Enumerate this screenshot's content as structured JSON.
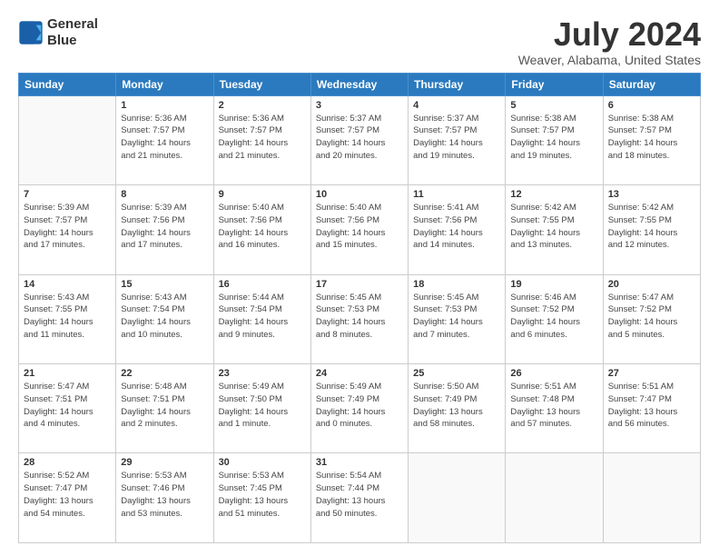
{
  "logo": {
    "line1": "General",
    "line2": "Blue"
  },
  "title": "July 2024",
  "subtitle": "Weaver, Alabama, United States",
  "headers": [
    "Sunday",
    "Monday",
    "Tuesday",
    "Wednesday",
    "Thursday",
    "Friday",
    "Saturday"
  ],
  "weeks": [
    [
      {
        "day": "",
        "info": ""
      },
      {
        "day": "1",
        "info": "Sunrise: 5:36 AM\nSunset: 7:57 PM\nDaylight: 14 hours\nand 21 minutes."
      },
      {
        "day": "2",
        "info": "Sunrise: 5:36 AM\nSunset: 7:57 PM\nDaylight: 14 hours\nand 21 minutes."
      },
      {
        "day": "3",
        "info": "Sunrise: 5:37 AM\nSunset: 7:57 PM\nDaylight: 14 hours\nand 20 minutes."
      },
      {
        "day": "4",
        "info": "Sunrise: 5:37 AM\nSunset: 7:57 PM\nDaylight: 14 hours\nand 19 minutes."
      },
      {
        "day": "5",
        "info": "Sunrise: 5:38 AM\nSunset: 7:57 PM\nDaylight: 14 hours\nand 19 minutes."
      },
      {
        "day": "6",
        "info": "Sunrise: 5:38 AM\nSunset: 7:57 PM\nDaylight: 14 hours\nand 18 minutes."
      }
    ],
    [
      {
        "day": "7",
        "info": "Sunrise: 5:39 AM\nSunset: 7:57 PM\nDaylight: 14 hours\nand 17 minutes."
      },
      {
        "day": "8",
        "info": "Sunrise: 5:39 AM\nSunset: 7:56 PM\nDaylight: 14 hours\nand 17 minutes."
      },
      {
        "day": "9",
        "info": "Sunrise: 5:40 AM\nSunset: 7:56 PM\nDaylight: 14 hours\nand 16 minutes."
      },
      {
        "day": "10",
        "info": "Sunrise: 5:40 AM\nSunset: 7:56 PM\nDaylight: 14 hours\nand 15 minutes."
      },
      {
        "day": "11",
        "info": "Sunrise: 5:41 AM\nSunset: 7:56 PM\nDaylight: 14 hours\nand 14 minutes."
      },
      {
        "day": "12",
        "info": "Sunrise: 5:42 AM\nSunset: 7:55 PM\nDaylight: 14 hours\nand 13 minutes."
      },
      {
        "day": "13",
        "info": "Sunrise: 5:42 AM\nSunset: 7:55 PM\nDaylight: 14 hours\nand 12 minutes."
      }
    ],
    [
      {
        "day": "14",
        "info": "Sunrise: 5:43 AM\nSunset: 7:55 PM\nDaylight: 14 hours\nand 11 minutes."
      },
      {
        "day": "15",
        "info": "Sunrise: 5:43 AM\nSunset: 7:54 PM\nDaylight: 14 hours\nand 10 minutes."
      },
      {
        "day": "16",
        "info": "Sunrise: 5:44 AM\nSunset: 7:54 PM\nDaylight: 14 hours\nand 9 minutes."
      },
      {
        "day": "17",
        "info": "Sunrise: 5:45 AM\nSunset: 7:53 PM\nDaylight: 14 hours\nand 8 minutes."
      },
      {
        "day": "18",
        "info": "Sunrise: 5:45 AM\nSunset: 7:53 PM\nDaylight: 14 hours\nand 7 minutes."
      },
      {
        "day": "19",
        "info": "Sunrise: 5:46 AM\nSunset: 7:52 PM\nDaylight: 14 hours\nand 6 minutes."
      },
      {
        "day": "20",
        "info": "Sunrise: 5:47 AM\nSunset: 7:52 PM\nDaylight: 14 hours\nand 5 minutes."
      }
    ],
    [
      {
        "day": "21",
        "info": "Sunrise: 5:47 AM\nSunset: 7:51 PM\nDaylight: 14 hours\nand 4 minutes."
      },
      {
        "day": "22",
        "info": "Sunrise: 5:48 AM\nSunset: 7:51 PM\nDaylight: 14 hours\nand 2 minutes."
      },
      {
        "day": "23",
        "info": "Sunrise: 5:49 AM\nSunset: 7:50 PM\nDaylight: 14 hours\nand 1 minute."
      },
      {
        "day": "24",
        "info": "Sunrise: 5:49 AM\nSunset: 7:49 PM\nDaylight: 14 hours\nand 0 minutes."
      },
      {
        "day": "25",
        "info": "Sunrise: 5:50 AM\nSunset: 7:49 PM\nDaylight: 13 hours\nand 58 minutes."
      },
      {
        "day": "26",
        "info": "Sunrise: 5:51 AM\nSunset: 7:48 PM\nDaylight: 13 hours\nand 57 minutes."
      },
      {
        "day": "27",
        "info": "Sunrise: 5:51 AM\nSunset: 7:47 PM\nDaylight: 13 hours\nand 56 minutes."
      }
    ],
    [
      {
        "day": "28",
        "info": "Sunrise: 5:52 AM\nSunset: 7:47 PM\nDaylight: 13 hours\nand 54 minutes."
      },
      {
        "day": "29",
        "info": "Sunrise: 5:53 AM\nSunset: 7:46 PM\nDaylight: 13 hours\nand 53 minutes."
      },
      {
        "day": "30",
        "info": "Sunrise: 5:53 AM\nSunset: 7:45 PM\nDaylight: 13 hours\nand 51 minutes."
      },
      {
        "day": "31",
        "info": "Sunrise: 5:54 AM\nSunset: 7:44 PM\nDaylight: 13 hours\nand 50 minutes."
      },
      {
        "day": "",
        "info": ""
      },
      {
        "day": "",
        "info": ""
      },
      {
        "day": "",
        "info": ""
      }
    ]
  ]
}
